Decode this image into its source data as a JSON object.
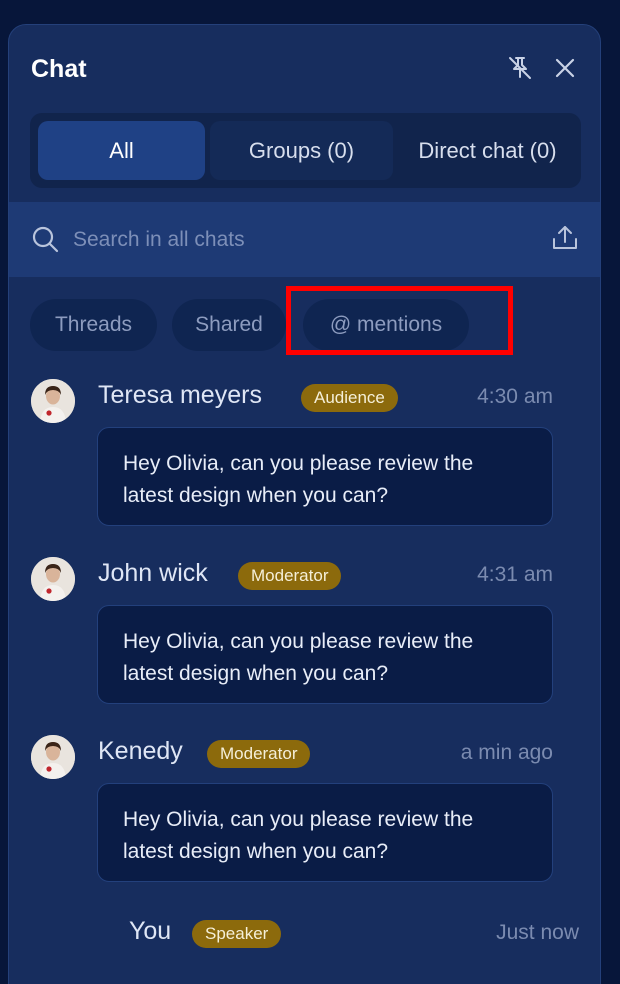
{
  "header": {
    "title": "Chat"
  },
  "tabs": [
    {
      "label": "All",
      "active": true
    },
    {
      "label": "Groups (0)",
      "active": false
    },
    {
      "label": "Direct chat (0)",
      "active": false
    }
  ],
  "search": {
    "placeholder": "Search in all chats",
    "value": ""
  },
  "filters": [
    {
      "label": "Threads"
    },
    {
      "label": "Shared"
    },
    {
      "label": "@ mentions"
    }
  ],
  "messages": [
    {
      "sender": "Teresa meyers",
      "role": "Audience",
      "time": "4:30 am",
      "text": "Hey Olivia, can you please review the latest design when you can?"
    },
    {
      "sender": "John wick",
      "role": "Moderator",
      "time": "4:31 am",
      "text": "Hey Olivia, can you please review the latest design when you can?"
    },
    {
      "sender": "Kenedy",
      "role": "Moderator",
      "time": "a min ago",
      "text": "Hey Olivia, can you please review the latest design when you can?"
    }
  ],
  "self": {
    "sender": "You",
    "role": "Speaker",
    "time": "Just now"
  },
  "colors": {
    "background": "#07163a",
    "panel": "#172d5e",
    "active_tab": "#1f4185",
    "badge": "#8c6a0c",
    "bubble": "#0a1c46",
    "self_bubble": "#1c65e6",
    "highlight": "#ff0000"
  },
  "icons": [
    "pin-off-icon",
    "close-icon",
    "search-icon",
    "upload-icon"
  ]
}
